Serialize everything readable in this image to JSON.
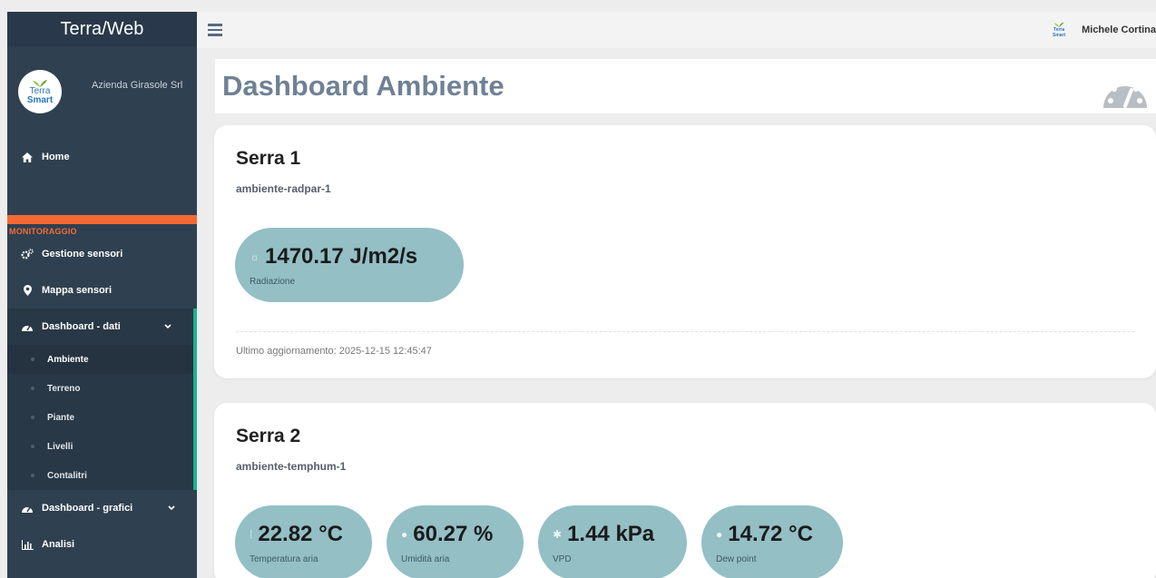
{
  "app": {
    "brand": "Terra/Web"
  },
  "profile": {
    "logo_line1": "Terra",
    "logo_line2": "Smart",
    "company": "Azienda Girasole Srl"
  },
  "sidebar": {
    "home": "Home",
    "section_label": "MONITORAGGIO",
    "items": [
      {
        "label": "Gestione sensori",
        "icon": "cogs-icon"
      },
      {
        "label": "Mappa sensori",
        "icon": "map-marker-icon"
      },
      {
        "label": "Dashboard - dati",
        "icon": "dashboard-icon",
        "expanded": true
      }
    ],
    "sub_items": [
      {
        "label": "Ambiente",
        "active": true
      },
      {
        "label": "Terreno"
      },
      {
        "label": "Piante"
      },
      {
        "label": "Livelli"
      },
      {
        "label": "Contalitri"
      }
    ],
    "after": [
      {
        "label": "Dashboard - grafici",
        "icon": "dashboard-icon"
      },
      {
        "label": "Analisi",
        "icon": "bar-chart-icon"
      }
    ]
  },
  "topbar": {
    "user_name": "Michele Cortina"
  },
  "page": {
    "title": "Dashboard Ambiente"
  },
  "cards": [
    {
      "title": "Serra 1",
      "code": "ambiente-radpar-1",
      "metrics": [
        {
          "value": "1470.17 J/m2/s",
          "label": "Radiazione",
          "icon": "sun-icon"
        }
      ],
      "updated": "Ultimo aggiornamento: 2025-12-15 12:45:47"
    },
    {
      "title": "Serra 2",
      "code": "ambiente-temphum-1",
      "metrics": [
        {
          "value": "22.82 °C",
          "label": "Temperatura aria",
          "icon": "thermometer-icon"
        },
        {
          "value": "60.27 %",
          "label": "Umidità aria",
          "icon": "droplet-icon"
        },
        {
          "value": "1.44 kPa",
          "label": "VPD",
          "icon": "asterisk-icon"
        },
        {
          "value": "14.72 °C",
          "label": "Dew point",
          "icon": "droplet-icon"
        }
      ]
    }
  ],
  "colors": {
    "sidebar": "#2f4050",
    "accent_orange": "#f46a35",
    "accent_green": "#1ab394",
    "pill": "#93bfc5",
    "title": "#6f8194"
  }
}
